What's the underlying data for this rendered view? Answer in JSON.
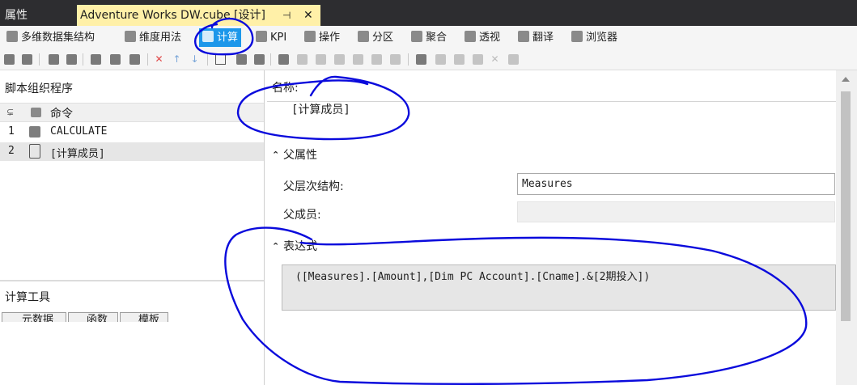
{
  "window": {
    "properties_tab": "属性",
    "document_tab": "Adventure Works DW.cube [设计]",
    "pin_glyph": "⊣",
    "close_glyph": "✕"
  },
  "designer_tabs": [
    {
      "label": "多维数据集结构",
      "icon": "cube-structure-icon"
    },
    {
      "label": "维度用法",
      "icon": "dimension-usage-icon"
    },
    {
      "label": "计算",
      "icon": "calculations-icon",
      "active": true
    },
    {
      "label": "KPI",
      "icon": "kpi-icon"
    },
    {
      "label": "操作",
      "icon": "actions-icon"
    },
    {
      "label": "分区",
      "icon": "partitions-icon"
    },
    {
      "label": "聚合",
      "icon": "aggregations-icon"
    },
    {
      "label": "透视",
      "icon": "perspectives-icon"
    },
    {
      "label": "翻译",
      "icon": "translations-icon"
    },
    {
      "label": "浏览器",
      "icon": "browser-icon"
    }
  ],
  "script_organizer": {
    "title": "脚本组织程序",
    "column_header": "命令",
    "rows": [
      {
        "num": "1",
        "text": "CALCULATE",
        "icon": "calculate-icon"
      },
      {
        "num": "2",
        "text": "[计算成员]",
        "icon": "calculated-member-icon"
      }
    ]
  },
  "calc_tools": {
    "title": "计算工具",
    "tabs": [
      "元数据",
      "函数",
      "模板"
    ]
  },
  "form": {
    "name_label": "名称:",
    "name_value": "[计算成员]",
    "parent_section": "父属性",
    "parent_hierarchy_label": "父层次结构:",
    "parent_hierarchy_value": "Measures",
    "parent_member_label": "父成员:",
    "parent_member_value": "",
    "expression_section": "表达式",
    "expression_value": "([Measures].[Amount],[Dim PC Account].[Cname].&[2期投入])"
  },
  "colors": {
    "tab_strip": "#2d2d30",
    "active_document_tab": "#fff0a8",
    "accent": "#1c97ea",
    "annotation_ink": "#0a0adc"
  }
}
